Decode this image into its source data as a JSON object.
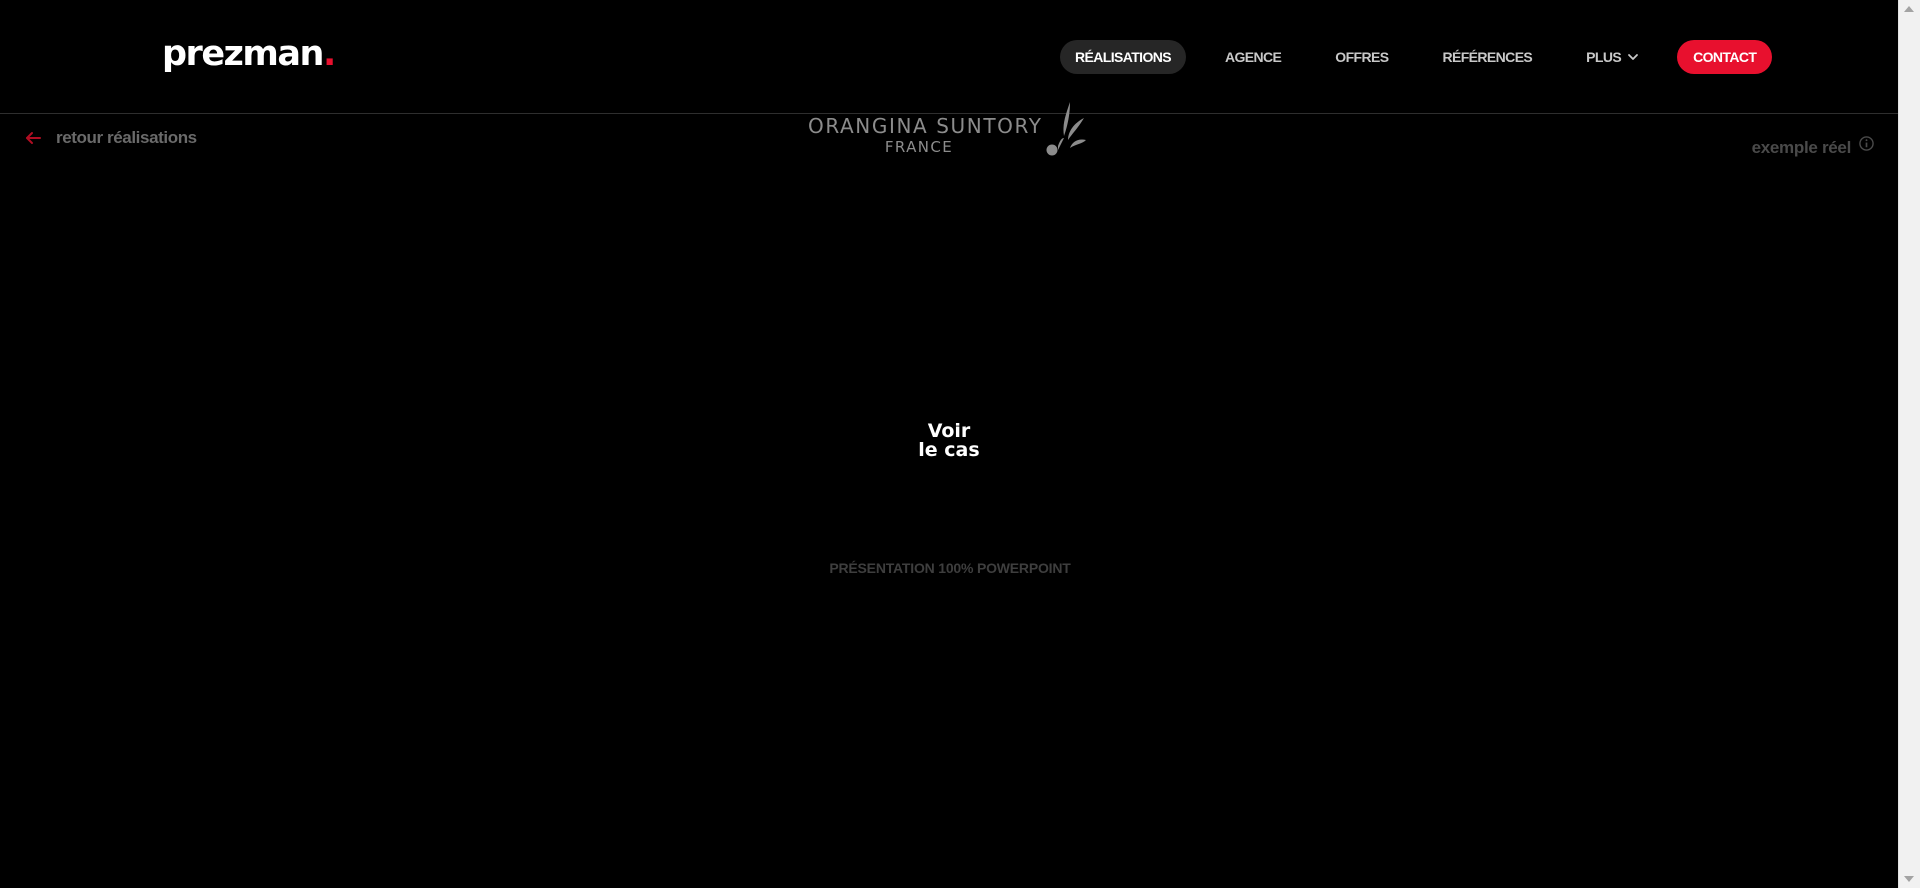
{
  "brand": {
    "name": "prezman",
    "dot": "."
  },
  "nav": {
    "items": [
      {
        "label": "RÉALISATIONS"
      },
      {
        "label": "AGENCE"
      },
      {
        "label": "OFFRES"
      },
      {
        "label": "RÉFÉRENCES"
      },
      {
        "label": "PLUS"
      }
    ],
    "contact_label": "CONTACT"
  },
  "back_link": {
    "label": "retour réalisations"
  },
  "client": {
    "name": "ORANGINA SUNTORY",
    "sub": "FRANCE"
  },
  "example": {
    "label": "exemple réel"
  },
  "cta": {
    "line1": "Voir",
    "line2": "le cas"
  },
  "presentation": {
    "label": "PRÉSENTATION 100% POWERPOINT"
  },
  "colors": {
    "accent": "#e8102e",
    "background": "#000000",
    "nav_active_bg": "#262626"
  },
  "icons": {
    "back": "arrow-left-icon",
    "plus": "chevron-down-icon",
    "info": "info-icon",
    "client_mark": "orangina-drop-icon"
  }
}
